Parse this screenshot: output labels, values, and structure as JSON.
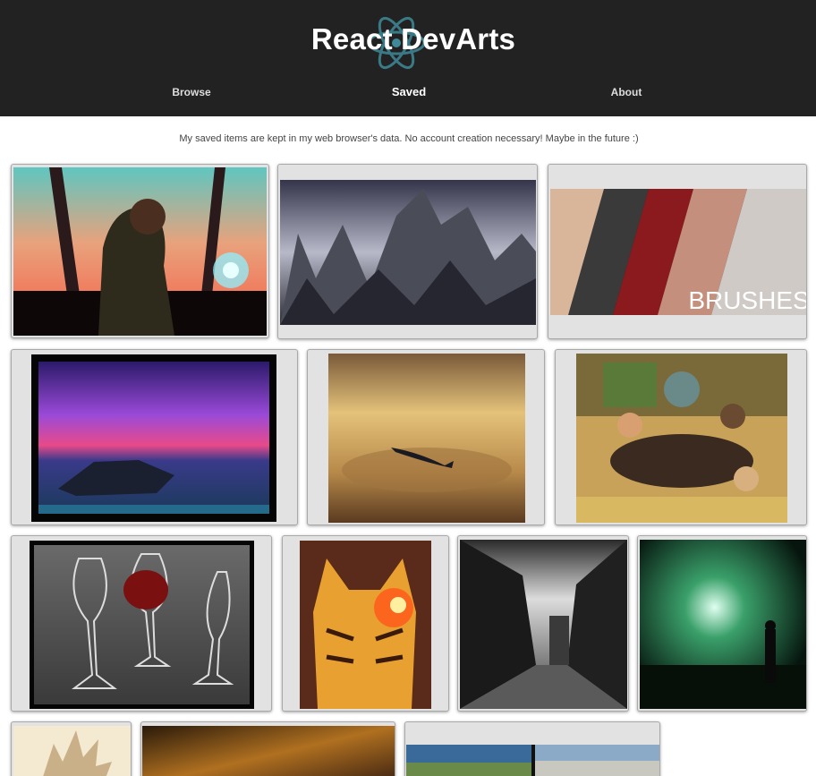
{
  "app": {
    "brand": "React DevArts",
    "logo_icon": "react-atom-icon",
    "accent": "#61dafb"
  },
  "nav": {
    "items": [
      {
        "id": "browse",
        "label": "Browse",
        "active": false
      },
      {
        "id": "saved",
        "label": "Saved",
        "active": true
      },
      {
        "id": "about",
        "label": "About",
        "active": false
      }
    ]
  },
  "notice": "My saved items are kept in my web browser's data. No account creation necessary! Maybe in the future :)",
  "gallery": {
    "items": [
      {
        "name": "saved-art-boy-with-glowing-orb"
      },
      {
        "name": "saved-art-misty-mountains"
      },
      {
        "name": "saved-art-portrait-brushes",
        "caption": "BRUSHES"
      },
      {
        "name": "saved-art-purple-seascape"
      },
      {
        "name": "saved-art-whale-in-clouds"
      },
      {
        "name": "saved-art-anime-feast"
      },
      {
        "name": "saved-art-wine-glasses"
      },
      {
        "name": "saved-art-fire-tiger"
      },
      {
        "name": "saved-art-dark-alley"
      },
      {
        "name": "saved-art-green-vortex"
      },
      {
        "name": "saved-art-spiky-hair-sketch"
      },
      {
        "name": "saved-art-golden-sky"
      },
      {
        "name": "saved-art-split-landscape"
      }
    ]
  }
}
